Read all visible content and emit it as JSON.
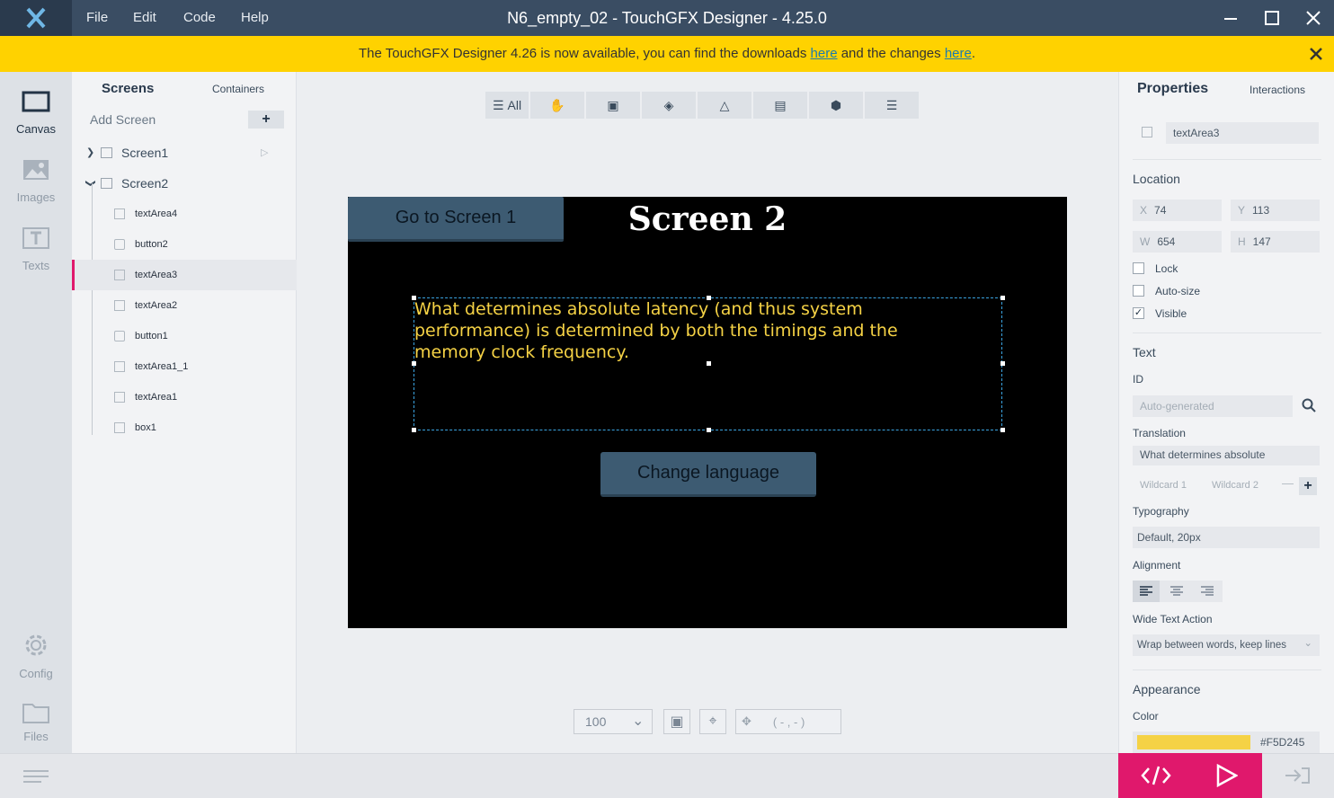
{
  "window": {
    "title": "N6_empty_02 - TouchGFX Designer - 4.25.0",
    "menu": [
      "File",
      "Edit",
      "Code",
      "Help"
    ]
  },
  "banner": {
    "text_before": "The TouchGFX Designer 4.26 is now available, you can find the downloads ",
    "link1": "here",
    "text_middle": " and the changes ",
    "link2": "here",
    "text_after": ".",
    "bg_color": "#FFD200"
  },
  "leftnav": {
    "items": [
      "Canvas",
      "Images",
      "Texts",
      "Config",
      "Files"
    ]
  },
  "screens_panel": {
    "tab_screens": "Screens",
    "tab_containers": "Containers",
    "add_screen": "Add Screen",
    "screen1": "Screen1",
    "screen2": "Screen2",
    "widgets": [
      {
        "name": "textArea4",
        "icon": "text"
      },
      {
        "name": "button2",
        "icon": "button"
      },
      {
        "name": "textArea3",
        "icon": "text"
      },
      {
        "name": "textArea2",
        "icon": "text"
      },
      {
        "name": "button1",
        "icon": "button"
      },
      {
        "name": "textArea1_1",
        "icon": "text"
      },
      {
        "name": "textArea1",
        "icon": "text"
      },
      {
        "name": "box1",
        "icon": "box"
      }
    ]
  },
  "canvas": {
    "filter_all": "All",
    "go_button": "Go to Screen 1",
    "screen_title": "Screen 2",
    "text_area": "What determines absolute latency (and thus system performance) is determined by both the timings and the memory clock frequency.",
    "change_language": "Change language",
    "zoom": "100",
    "coords": "( - , - )"
  },
  "properties": {
    "tab_properties": "Properties",
    "tab_interactions": "Interactions",
    "name": "textArea3",
    "location_heading": "Location",
    "x_label": "X",
    "x": "74",
    "y_label": "Y",
    "y": "113",
    "w_label": "W",
    "w": "654",
    "h_label": "H",
    "h": "147",
    "lock": "Lock",
    "autosize": "Auto-size",
    "visible": "Visible",
    "text_heading": "Text",
    "id_label": "ID",
    "id_placeholder": "Auto-generated",
    "translation_label": "Translation",
    "translation_value": "What determines absolute",
    "wildcard1": "Wildcard 1",
    "wildcard2": "Wildcard 2",
    "typography_label": "Typography",
    "typography_value": "Default, 20px",
    "alignment_label": "Alignment",
    "wide_text_label": "Wide Text Action",
    "wide_text_value": "Wrap between words, keep lines",
    "appearance_heading": "Appearance",
    "color_label": "Color",
    "color_value": "#F5D245"
  },
  "colors": {
    "accent": "#E0186C",
    "text_color": "#F5D245",
    "titlebar": "#3A4D63"
  }
}
